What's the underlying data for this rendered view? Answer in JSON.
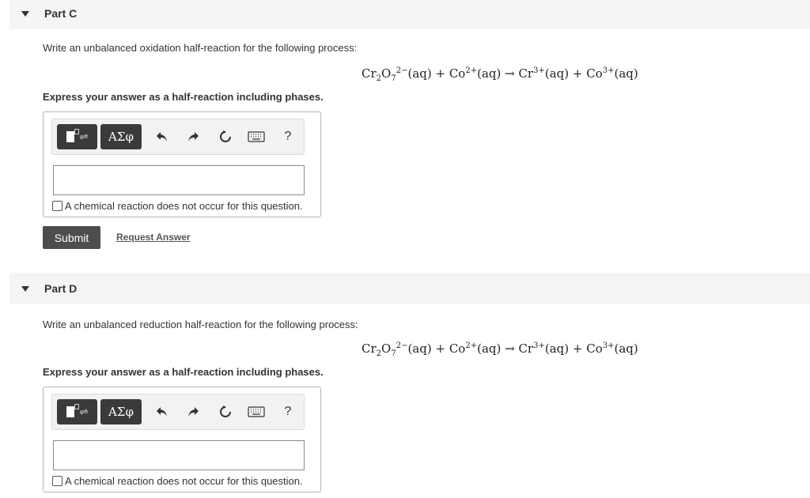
{
  "part_c": {
    "title": "Part C",
    "prompt": "Write an unbalanced oxidation half-reaction for the following process:",
    "equation": {
      "reactant1_base": "Cr",
      "reactant1_sub1": "2",
      "reactant1_o": "O",
      "reactant1_sub2": "7",
      "reactant1_charge": "2−",
      "reactant1_phase": "(aq)",
      "plus1": " + ",
      "reactant2_base": "Co",
      "reactant2_charge": "2+",
      "reactant2_phase": "(aq)",
      "arrow": " → ",
      "product1_base": "Cr",
      "product1_charge": "3+",
      "product1_phase": "(aq)",
      "plus2": " + ",
      "product2_base": "Co",
      "product2_charge": "3+",
      "product2_phase": "(aq)"
    },
    "express": "Express your answer as a half-reaction including phases.",
    "symbols_label": "ΑΣφ",
    "help_label": "?",
    "input_value": "",
    "no_reaction_label": "A chemical reaction does not occur for this question.",
    "submit_label": "Submit",
    "request_label": "Request Answer"
  },
  "part_d": {
    "title": "Part D",
    "prompt": "Write an unbalanced reduction half-reaction for the following process:",
    "equation": {
      "reactant1_base": "Cr",
      "reactant1_sub1": "2",
      "reactant1_o": "O",
      "reactant1_sub2": "7",
      "reactant1_charge": "2−",
      "reactant1_phase": "(aq)",
      "plus1": " + ",
      "reactant2_base": "Co",
      "reactant2_charge": "2+",
      "reactant2_phase": "(aq)",
      "arrow": " → ",
      "product1_base": "Cr",
      "product1_charge": "3+",
      "product1_phase": "(aq)",
      "plus2": " + ",
      "product2_base": "Co",
      "product2_charge": "3+",
      "product2_phase": "(aq)"
    },
    "express": "Express your answer as a half-reaction including phases.",
    "symbols_label": "ΑΣφ",
    "help_label": "?",
    "input_value": "",
    "no_reaction_label": "A chemical reaction does not occur for this question."
  }
}
